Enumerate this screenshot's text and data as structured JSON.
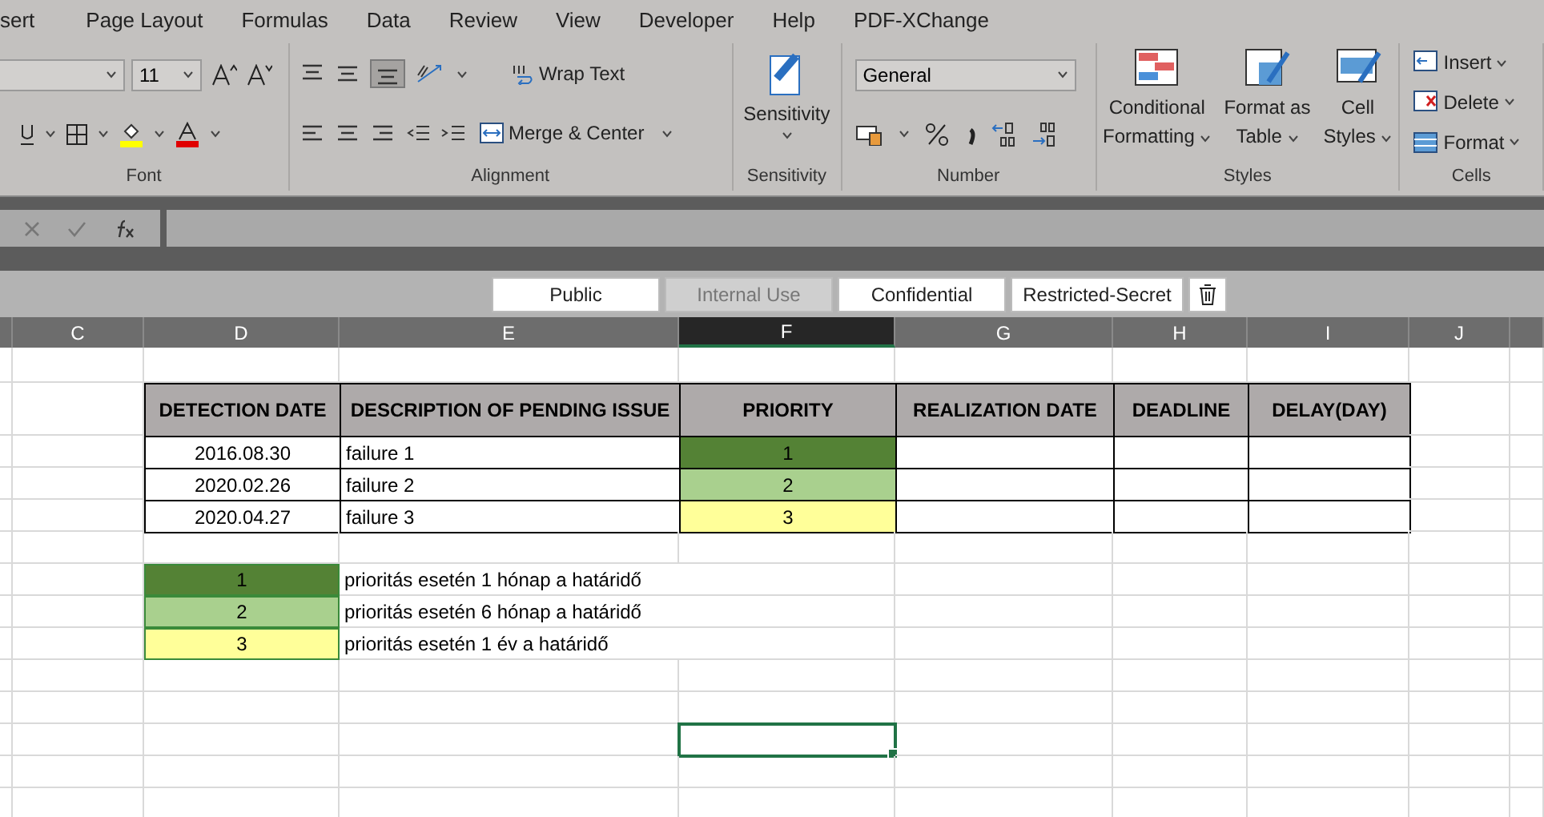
{
  "ribbon_tabs": [
    "sert",
    "Page Layout",
    "Formulas",
    "Data",
    "Review",
    "View",
    "Developer",
    "Help",
    "PDF-XChange"
  ],
  "ribbon": {
    "font": {
      "size": "11",
      "label": "Font"
    },
    "alignment": {
      "wrap": "Wrap Text",
      "merge": "Merge & Center",
      "label": "Alignment"
    },
    "sensitivity": {
      "button": "Sensitivity",
      "label": "Sensitivity"
    },
    "number": {
      "format": "General",
      "label": "Number"
    },
    "styles": {
      "buttons": [
        {
          "line1": "Conditional",
          "line2": "Formatting"
        },
        {
          "line1": "Format as",
          "line2": "Table"
        },
        {
          "line1": "Cell",
          "line2": "Styles"
        }
      ],
      "label": "Styles"
    },
    "cells": {
      "buttons": [
        "Insert",
        "Delete",
        "Format"
      ],
      "label": "Cells"
    }
  },
  "classification": [
    {
      "label": "Public",
      "selected": false
    },
    {
      "label": "Internal Use",
      "selected": true
    },
    {
      "label": "Confidential",
      "selected": false
    },
    {
      "label": "Restricted-Secret",
      "selected": false
    }
  ],
  "column_headers": [
    {
      "label": "C",
      "selected": false
    },
    {
      "label": "D",
      "selected": false
    },
    {
      "label": "E",
      "selected": false
    },
    {
      "label": "F",
      "selected": true
    },
    {
      "label": "G",
      "selected": false
    },
    {
      "label": "H",
      "selected": false
    },
    {
      "label": "I",
      "selected": false
    },
    {
      "label": "J",
      "selected": false
    }
  ],
  "table": {
    "columns": [
      "DETECTION DATE",
      "DESCRIPTION OF PENDING ISSUE",
      "PRIORITY",
      "REALIZATION DATE",
      "DEADLINE",
      "DELAY(DAY)"
    ],
    "rows": [
      {
        "date": "2016.08.30",
        "description": "failure 1",
        "priority": "1",
        "color": "#548235"
      },
      {
        "date": "2020.02.26",
        "description": "failure 2",
        "priority": "2",
        "color": "#a9d08e"
      },
      {
        "date": "2020.04.27",
        "description": "failure 3",
        "priority": "3",
        "color": "#ffff99"
      }
    ]
  },
  "legend": [
    {
      "priority": "1",
      "text": "prioritás esetén 1 hónap a határidő",
      "color": "#548235"
    },
    {
      "priority": "2",
      "text": "prioritás esetén 6 hónap a határidő",
      "color": "#a9d08e"
    },
    {
      "priority": "3",
      "text": "prioritás esetén 1 év a határidő",
      "color": "#ffff99"
    }
  ]
}
